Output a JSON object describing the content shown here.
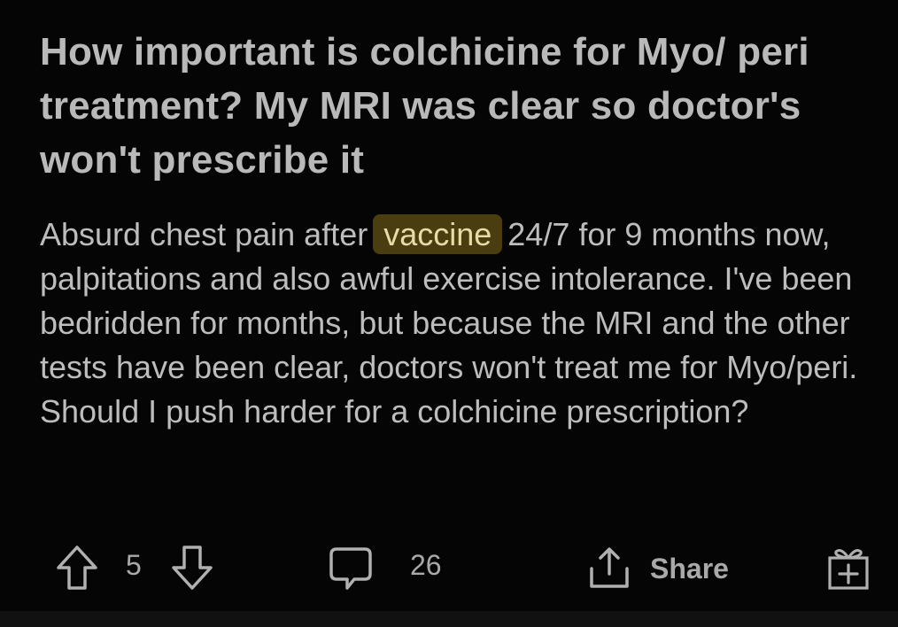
{
  "post": {
    "title": "How important is colchicine for Myo/ peri treatment? My MRI was clear so doctor's won't prescribe it",
    "body_before": "Absurd chest pain after ",
    "body_highlight": "vaccine",
    "body_after": " 24/7 for 9 months now, palpitations and also awful exercise intolerance. I've been bedridden for months, but because the MRI and the other tests have been clear, doctors won't treat me for Myo/peri. Should I push harder for a colchicine prescription?"
  },
  "actions": {
    "vote_count": "5",
    "comment_count": "26",
    "share_label": "Share"
  },
  "icons": {
    "upvote": "arrow-up-icon",
    "downvote": "arrow-down-icon",
    "comment": "comment-bubble-icon",
    "share": "share-icon",
    "award": "gift-icon"
  },
  "colors": {
    "background": "#000000",
    "highlight_bg": "#4a3d10",
    "text": "#bdbdbd"
  }
}
